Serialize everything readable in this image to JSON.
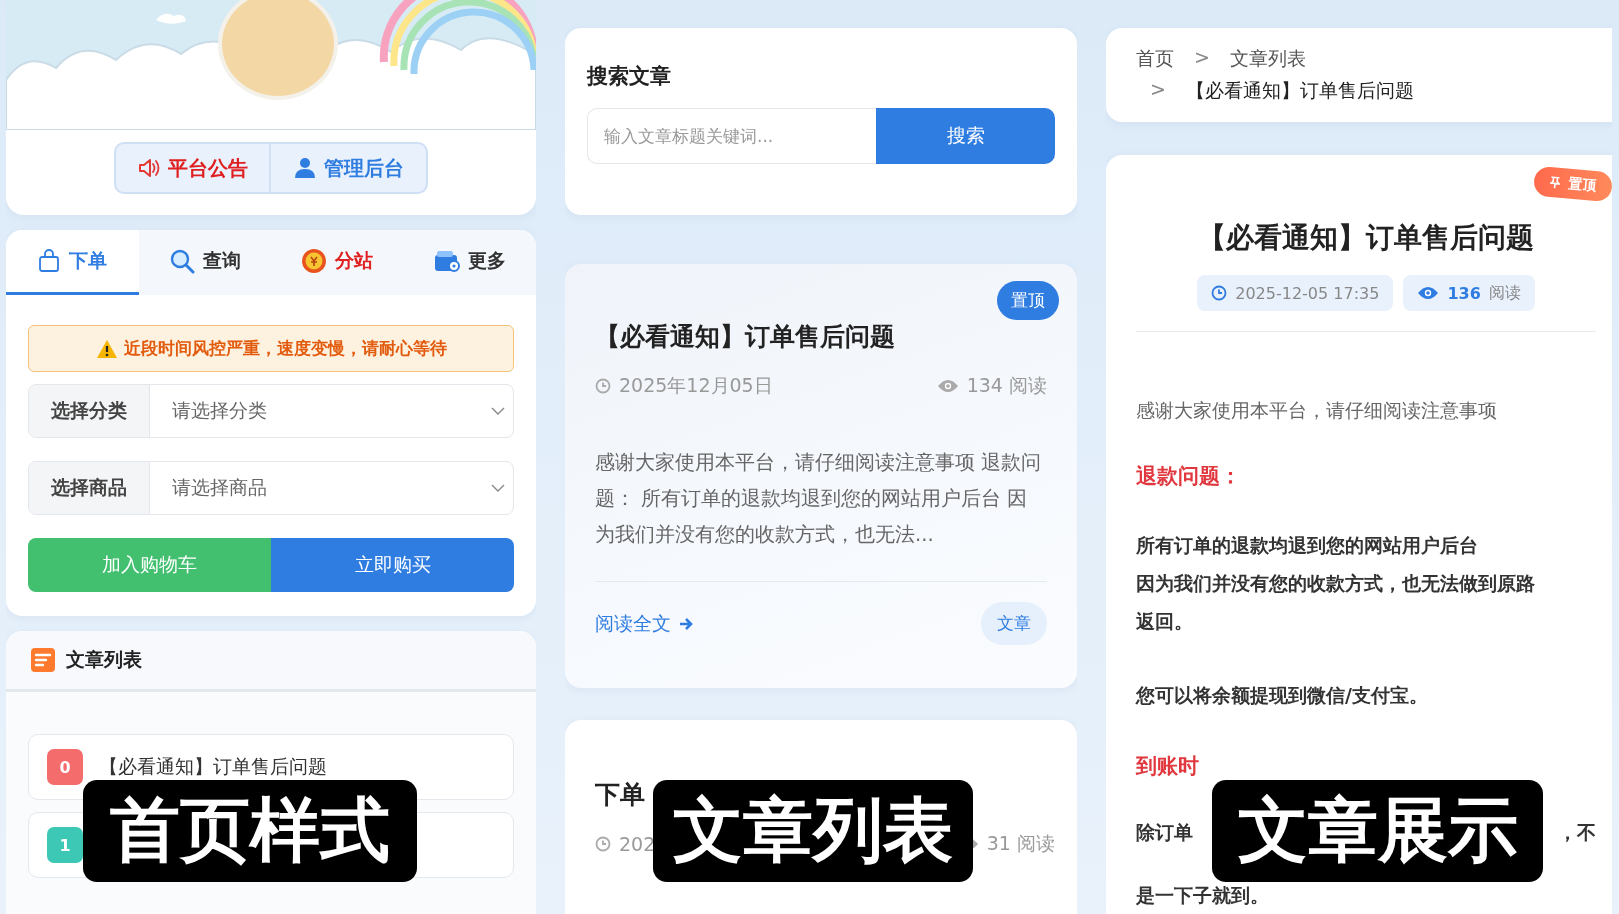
{
  "home": {
    "caption": "首页样式",
    "header_buttons": [
      {
        "label": "平台公告",
        "kind": "announce"
      },
      {
        "label": "管理后台",
        "kind": "admin"
      }
    ],
    "tabs": [
      {
        "label": "下单",
        "kind": "bag",
        "selected": true
      },
      {
        "label": "查询",
        "kind": "search",
        "selected": false
      },
      {
        "label": "分站",
        "kind": "coin",
        "selected": false
      },
      {
        "label": "更多",
        "kind": "wallet",
        "selected": false
      }
    ],
    "notice": "近段时间风控严重，速度变慢，请耐心等待",
    "selects": [
      {
        "label": "选择分类",
        "placeholder": "请选择分类"
      },
      {
        "label": "选择商品",
        "placeholder": "请选择商品"
      }
    ],
    "actions": [
      {
        "label": "加入购物车",
        "kind": "cart"
      },
      {
        "label": "立即购买",
        "kind": "buy"
      }
    ],
    "article_list": {
      "title": "文章列表",
      "items": [
        {
          "index": "0",
          "title": "【必看通知】订单售后问题",
          "color": "#f56c6c"
        },
        {
          "index": "1",
          "color": "#3cc8b4"
        }
      ]
    }
  },
  "article_list": {
    "caption": "文章列表",
    "search": {
      "title": "搜索文章",
      "placeholder": "输入文章标题关键词...",
      "button": "搜索"
    },
    "articles": [
      {
        "title": "【必看通知】订单售后问题",
        "pinned": true,
        "pin_label": "置顶",
        "date": "2025年12月05日",
        "views": "134 阅读",
        "excerpt": "感谢大家使用本平台，请仔细阅读注意事项 退款问题： 所有订单的退款均退到您的网站用户后台 因为我们并没有您的收款方式，也无法...",
        "read_more": "阅读全文",
        "tag": "文章"
      },
      {
        "title": "下单",
        "pinned": false,
        "date": "202",
        "views": "31 阅读"
      }
    ]
  },
  "article_view": {
    "caption": "文章展示",
    "breadcrumb": [
      {
        "kind": "link",
        "label": "首页"
      },
      {
        "kind": "sep",
        "label": ">"
      },
      {
        "kind": "link",
        "label": "文章列表"
      },
      {
        "kind": "sep",
        "label": ">"
      },
      {
        "kind": "current",
        "label": "【必看通知】订单售后问题"
      }
    ],
    "pinned": true,
    "pin_label": "置顶",
    "title": "【必看通知】订单售后问题",
    "date": "2025-12-05 17:35",
    "views": "136",
    "views_unit": "阅读",
    "body": [
      {
        "kind": "text",
        "lines": [
          "感谢大家使用本平台，请仔细阅读注意事项"
        ]
      },
      {
        "kind": "heading",
        "lines": [
          "退款问题："
        ]
      },
      {
        "kind": "strong",
        "lines": [
          "所有订单的退款均退到您的网站用户后台",
          "因为我们并没有您的收款方式，也无法做到原路返回。"
        ]
      },
      {
        "kind": "strong",
        "lines": [
          "您可以将余额提现到微信/支付宝。"
        ]
      },
      {
        "kind": "heading",
        "lines": [
          "到账时"
        ]
      },
      {
        "kind": "split",
        "lines": [
          "除订单",
          "，不"
        ]
      },
      {
        "kind": "strong",
        "lines": [
          "是一下子就到。"
        ]
      }
    ]
  }
}
